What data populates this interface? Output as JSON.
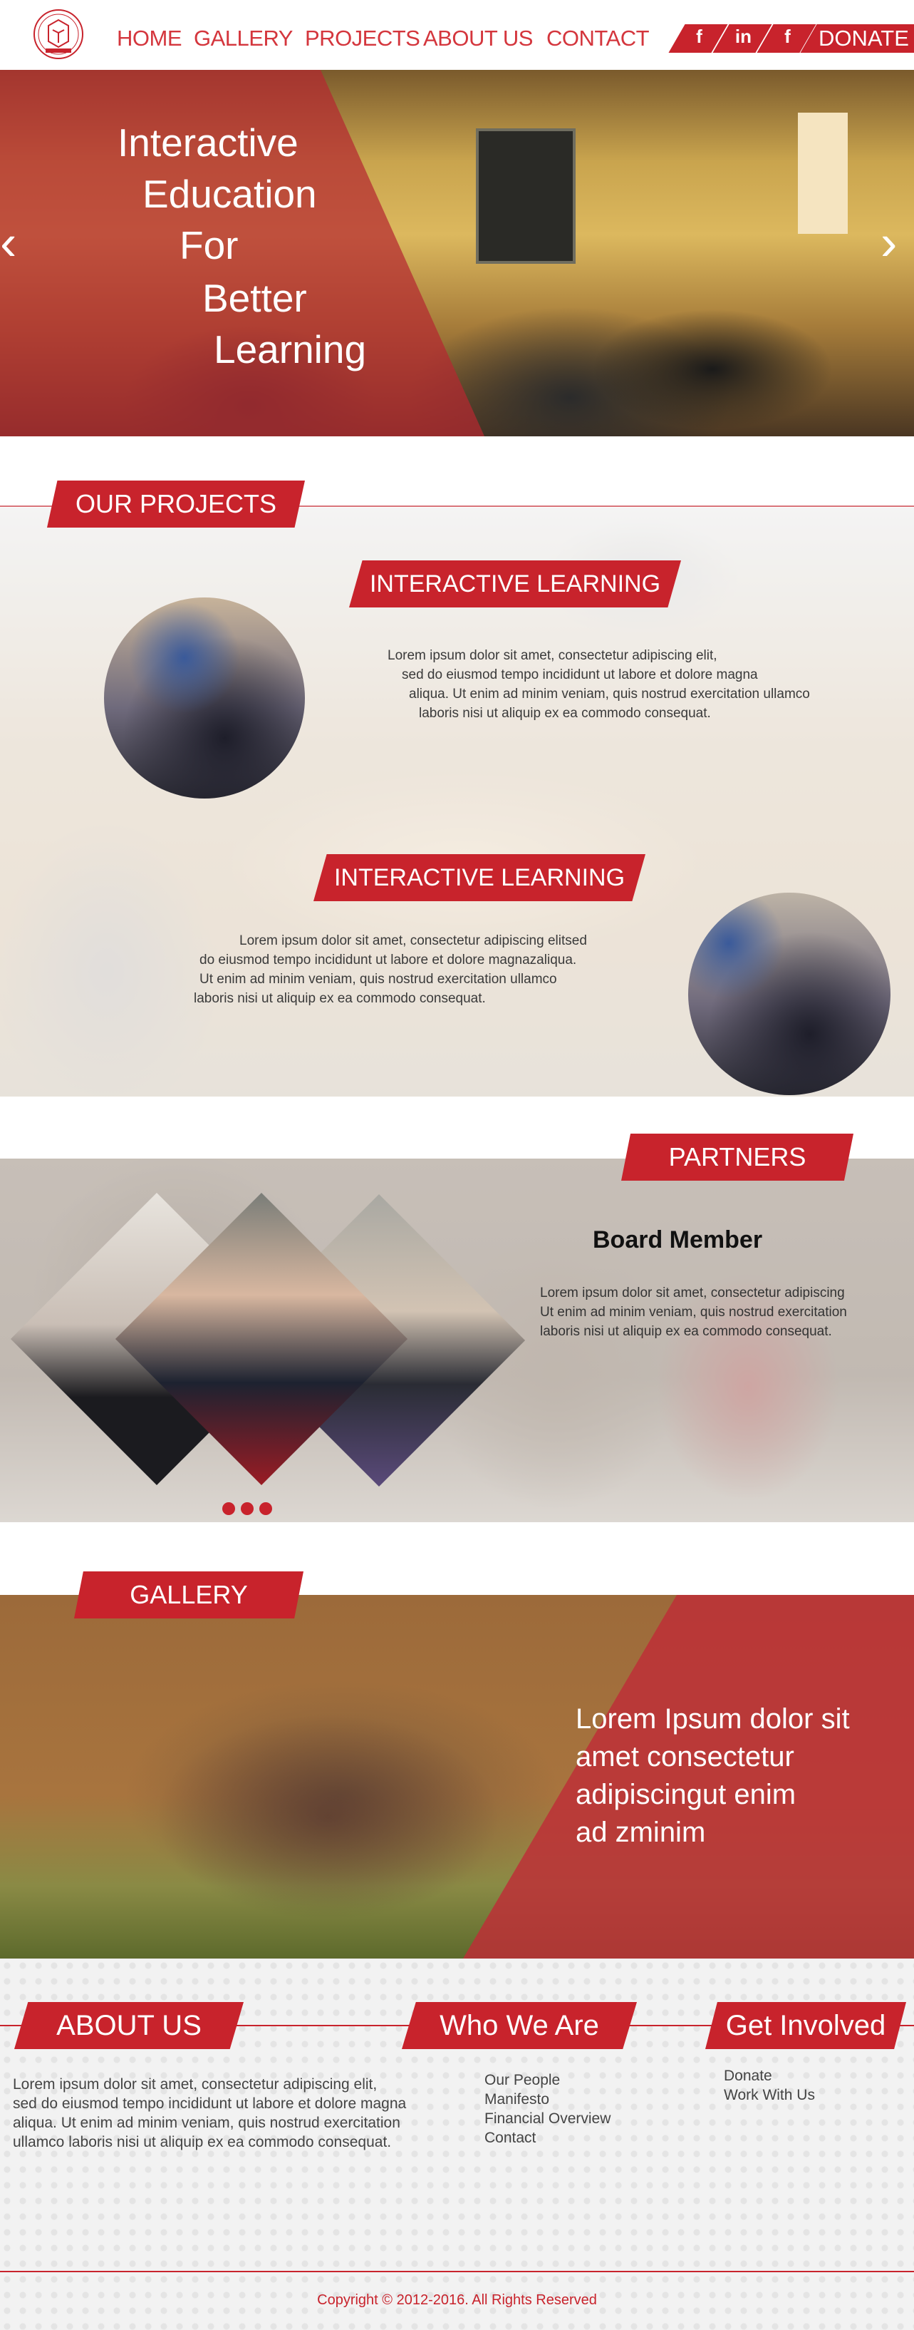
{
  "header": {
    "logo": "school-crest-logo",
    "nav": [
      "HOME",
      "GALLERY",
      "PROJECTS",
      "ABOUT US",
      "CONTACT"
    ],
    "social": [
      {
        "icon": "facebook-icon",
        "glyph": "f"
      },
      {
        "icon": "linkedin-icon",
        "glyph": "in"
      },
      {
        "icon": "facebook-icon",
        "glyph": "f"
      }
    ],
    "donate_label": "DONATE"
  },
  "hero": {
    "lines": [
      "Interactive",
      "Education",
      "For",
      "Better",
      "Learning"
    ],
    "prev_icon": "chevron-left-icon",
    "next_icon": "chevron-right-icon",
    "prev_glyph": "‹",
    "next_glyph": "›"
  },
  "projects": {
    "heading": "OUR PROJECTS",
    "items": [
      {
        "title": "INTERACTIVE LEARNING",
        "text": [
          "Lorem ipsum dolor sit amet, consectetur adipiscing elit,",
          "sed do eiusmod tempo incididunt ut labore et dolore magna",
          "aliqua. Ut enim ad minim veniam, quis nostrud exercitation ullamco",
          "laboris nisi ut aliquip ex ea commodo consequat."
        ]
      },
      {
        "title": "INTERACTIVE LEARNING",
        "text": [
          "Lorem ipsum dolor sit amet, consectetur adipiscing elitsed",
          "do eiusmod tempo incididunt ut labore et dolore magnazaliqua.",
          "Ut enim ad minim veniam, quis nostrud exercitation ullamco",
          "laboris nisi ut aliquip ex ea commodo consequat."
        ]
      }
    ]
  },
  "partners": {
    "heading": "PARTNERS",
    "member_title": "Board Member",
    "member_text": [
      "Lorem ipsum dolor sit amet, consectetur adipiscing",
      "Ut enim ad minim veniam, quis nostrud exercitation",
      "laboris nisi ut aliquip ex ea commodo consequat."
    ],
    "slide_count": 3
  },
  "gallery": {
    "heading": "GALLERY",
    "caption": [
      "Lorem Ipsum dolor sit",
      "amet consectetur",
      "adipiscingut enim",
      "ad zminim"
    ]
  },
  "footer": {
    "about_heading": "ABOUT US",
    "about_text": [
      "Lorem ipsum dolor sit amet, consectetur adipiscing elit,",
      "sed do eiusmod tempo incididunt ut labore et dolore magna",
      "aliqua. Ut enim ad minim veniam, quis nostrud exercitation",
      "ullamco laboris nisi ut aliquip ex ea commodo consequat."
    ],
    "who_heading": "Who We Are",
    "who_links": [
      "Our People",
      "Manifesto",
      "Financial Overview",
      "Contact"
    ],
    "involved_heading": "Get Involved",
    "involved_links": [
      "Donate",
      "Work With Us"
    ],
    "copyright": "Copyright © 2012-2016. All Rights Reserved"
  },
  "colors": {
    "accent": "#c8232c",
    "nav_text": "#d4363d"
  }
}
